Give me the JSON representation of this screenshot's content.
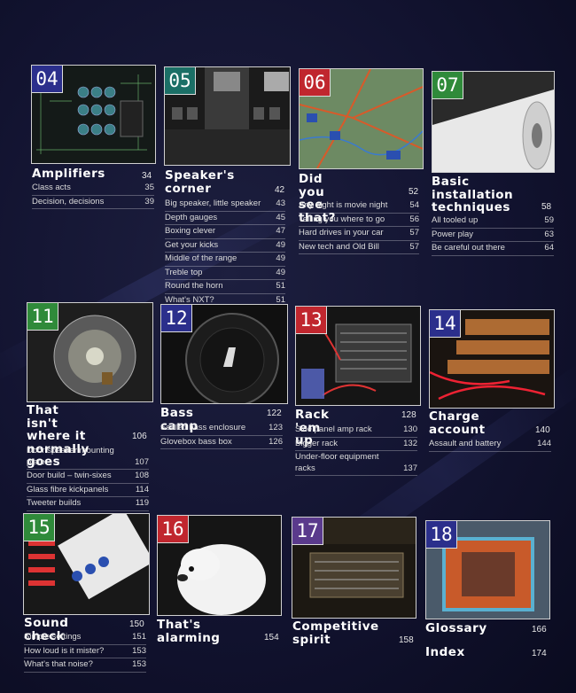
{
  "colors": {
    "purple": "#2b2f8c",
    "green": "#2f8a3a",
    "red": "#c0262e",
    "navy": "#2b2f8c",
    "teal": "#1b6f66",
    "violet": "#5a3a8c"
  },
  "sections": [
    {
      "num": "04",
      "color": "#2b2f8c",
      "image": "amplifier-circuit-board-photo",
      "title": [
        "Amplifiers"
      ],
      "page": "34",
      "entries": [
        {
          "label": "Class acts",
          "page": "35"
        },
        {
          "label": "Decision, decisions",
          "page": "39"
        }
      ]
    },
    {
      "num": "05",
      "color": "#1b6f66",
      "image": "speaker-grille-photo",
      "title": [
        "Speaker's",
        "corner"
      ],
      "page": "42",
      "entries": [
        {
          "label": "Big speaker, little speaker",
          "page": "43"
        },
        {
          "label": "Depth gauges",
          "page": "45"
        },
        {
          "label": "Boxing clever",
          "page": "47"
        },
        {
          "label": "Get your kicks",
          "page": "49"
        },
        {
          "label": "Middle of the range",
          "page": "49"
        },
        {
          "label": "Treble top",
          "page": "49"
        },
        {
          "label": "Round the horn",
          "page": "51"
        },
        {
          "label": "What's NXT?",
          "page": "51"
        }
      ]
    },
    {
      "num": "06",
      "color": "#c0262e",
      "image": "sat-nav-map-photo",
      "title": [
        "Did you see",
        "that?"
      ],
      "page": "52",
      "entries": [
        {
          "label": "Any night is movie night",
          "page": "54"
        },
        {
          "label": "Telling you where to go",
          "page": "56"
        },
        {
          "label": "Hard drives in your car",
          "page": "57"
        },
        {
          "label": "New tech and Old Bill",
          "page": "57"
        }
      ]
    },
    {
      "num": "07",
      "color": "#2f8a3a",
      "image": "sound-deadening-roll-photo",
      "title": [
        "Basic",
        "installation",
        "techniques"
      ],
      "page": "58",
      "entries": [
        {
          "label": "All tooled up",
          "page": "59"
        },
        {
          "label": "Power play",
          "page": "63"
        },
        {
          "label": "Be careful out there",
          "page": "64"
        }
      ]
    },
    {
      "num": "11",
      "color": "#2f8a3a",
      "image": "door-speaker-photo",
      "title": [
        "That isn't",
        "where it",
        "normally goes"
      ],
      "page": "106",
      "entries": [
        {
          "label": "Door speaker mounting plate",
          "page": "107"
        },
        {
          "label": "Door build – twin-sixes",
          "page": "108"
        },
        {
          "label": "Glass fibre kickpanels",
          "page": "114"
        },
        {
          "label": "Tweeter builds",
          "page": "119"
        }
      ]
    },
    {
      "num": "12",
      "color": "#2b2f8c",
      "image": "jl-subwoofer-photo",
      "title": [
        "Bass camp"
      ],
      "page": "122",
      "entries": [
        {
          "label": "Sealed bass enclosure",
          "page": "123"
        },
        {
          "label": "Glovebox bass box",
          "page": "126"
        }
      ]
    },
    {
      "num": "13",
      "color": "#c0262e",
      "image": "amplifier-rack-photo",
      "title": [
        "Rack 'em up"
      ],
      "page": "128",
      "entries": [
        {
          "label": "Side panel amp rack",
          "page": "130"
        },
        {
          "label": "Bigger rack",
          "page": "132"
        },
        {
          "label": "Under-floor equipment racks",
          "page": "137"
        }
      ]
    },
    {
      "num": "14",
      "color": "#2b2f8c",
      "image": "battery-wiring-photo",
      "title": [
        "Charge",
        "account"
      ],
      "page": "140",
      "entries": [
        {
          "label": "Assault and battery",
          "page": "144"
        }
      ]
    },
    {
      "num": "15",
      "color": "#2f8a3a",
      "image": "audio-processor-photo",
      "title": [
        "Sound check"
      ],
      "page": "150",
      "entries": [
        {
          "label": "Simple settings",
          "page": "151"
        },
        {
          "label": "How loud is it mister?",
          "page": "153"
        },
        {
          "label": "What's that noise?",
          "page": "153"
        }
      ]
    },
    {
      "num": "16",
      "color": "#c0262e",
      "image": "guard-dog-photo",
      "title": [
        "That's",
        "alarming"
      ],
      "page": "154",
      "entries": []
    },
    {
      "num": "17",
      "color": "#5a3a8c",
      "image": "competition-car-install-photo",
      "title": [
        "Competitive",
        "spirit"
      ],
      "page": "158",
      "entries": []
    },
    {
      "num": "18",
      "color": "#2b2f8c",
      "image": "custom-speaker-enclosure-photo",
      "title": [
        "Glossary"
      ],
      "page": "166",
      "entries": [],
      "extra": {
        "title": "Index",
        "page": "174"
      }
    }
  ]
}
